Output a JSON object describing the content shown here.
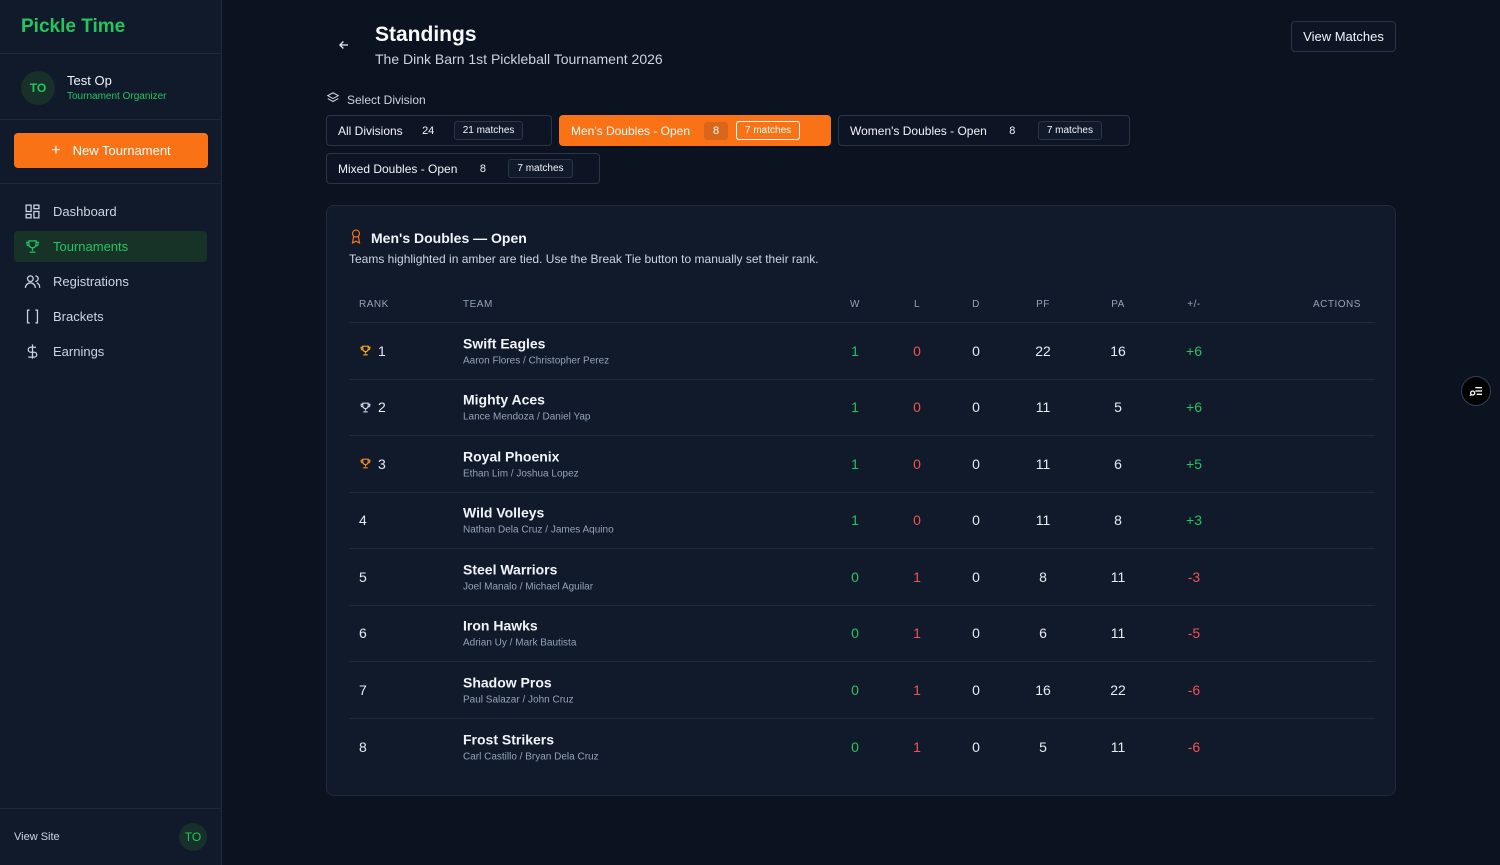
{
  "app": {
    "brand": "Pickle Time"
  },
  "user": {
    "initials": "TO",
    "name": "Test Op",
    "role": "Tournament Organizer"
  },
  "sidebar": {
    "new_tournament_label": "New Tournament",
    "items": [
      {
        "label": "Dashboard",
        "icon": "grid-icon",
        "active": false
      },
      {
        "label": "Tournaments",
        "icon": "trophy-icon",
        "active": true
      },
      {
        "label": "Registrations",
        "icon": "users-icon",
        "active": false
      },
      {
        "label": "Brackets",
        "icon": "brackets-icon",
        "active": false
      },
      {
        "label": "Earnings",
        "icon": "dollar-icon",
        "active": false
      }
    ],
    "view_site_label": "View Site"
  },
  "header": {
    "title": "Standings",
    "subtitle": "The Dink Barn 1st Pickleball Tournament 2026",
    "view_matches_label": "View Matches"
  },
  "divisions": {
    "label": "Select Division",
    "items": [
      {
        "name": "All Divisions",
        "count": "24",
        "matches": "21 matches",
        "active": false
      },
      {
        "name": "Men's Doubles - Open",
        "count": "8",
        "matches": "7 matches",
        "active": true
      },
      {
        "name": "Women's Doubles - Open",
        "count": "8",
        "matches": "7 matches",
        "active": false
      },
      {
        "name": "Mixed Doubles - Open",
        "count": "8",
        "matches": "7 matches",
        "active": false
      }
    ]
  },
  "standings": {
    "title": "Men's Doubles — Open",
    "note": "Teams highlighted in amber are tied. Use the Break Tie button to manually set their rank.",
    "columns": {
      "rank": "RANK",
      "team": "TEAM",
      "w": "W",
      "l": "L",
      "d": "D",
      "pf": "PF",
      "pa": "PA",
      "diff": "+/-",
      "actions": "ACTIONS"
    },
    "rows": [
      {
        "rank": "1",
        "trophy": "gold",
        "team": "Swift Eagles",
        "players": "Aaron Flores / Christopher Perez",
        "w": "1",
        "l": "0",
        "d": "0",
        "pf": "22",
        "pa": "16",
        "diff": "+6"
      },
      {
        "rank": "2",
        "trophy": "silver",
        "team": "Mighty Aces",
        "players": "Lance Mendoza / Daniel Yap",
        "w": "1",
        "l": "0",
        "d": "0",
        "pf": "11",
        "pa": "5",
        "diff": "+6"
      },
      {
        "rank": "3",
        "trophy": "bronze",
        "team": "Royal Phoenix",
        "players": "Ethan Lim / Joshua Lopez",
        "w": "1",
        "l": "0",
        "d": "0",
        "pf": "11",
        "pa": "6",
        "diff": "+5"
      },
      {
        "rank": "4",
        "trophy": "",
        "team": "Wild Volleys",
        "players": "Nathan Dela Cruz / James Aquino",
        "w": "1",
        "l": "0",
        "d": "0",
        "pf": "11",
        "pa": "8",
        "diff": "+3"
      },
      {
        "rank": "5",
        "trophy": "",
        "team": "Steel Warriors",
        "players": "Joel Manalo / Michael Aguilar",
        "w": "0",
        "l": "1",
        "d": "0",
        "pf": "8",
        "pa": "11",
        "diff": "-3"
      },
      {
        "rank": "6",
        "trophy": "",
        "team": "Iron Hawks",
        "players": "Adrian Uy / Mark Bautista",
        "w": "0",
        "l": "1",
        "d": "0",
        "pf": "6",
        "pa": "11",
        "diff": "-5"
      },
      {
        "rank": "7",
        "trophy": "",
        "team": "Shadow Pros",
        "players": "Paul Salazar / John Cruz",
        "w": "0",
        "l": "1",
        "d": "0",
        "pf": "16",
        "pa": "22",
        "diff": "-6"
      },
      {
        "rank": "8",
        "trophy": "",
        "team": "Frost Strikers",
        "players": "Carl Castillo / Bryan Dela Cruz",
        "w": "0",
        "l": "1",
        "d": "0",
        "pf": "5",
        "pa": "11",
        "diff": "-6"
      }
    ]
  },
  "colors": {
    "accent_orange": "#f97316",
    "accent_green": "#22c55e",
    "negative_red": "#f05252",
    "trophy_gold": "#f5a524",
    "trophy_silver": "#cbd5e1",
    "trophy_bronze": "#f08a24"
  },
  "floating": {
    "icon": "filter-settings-icon"
  }
}
